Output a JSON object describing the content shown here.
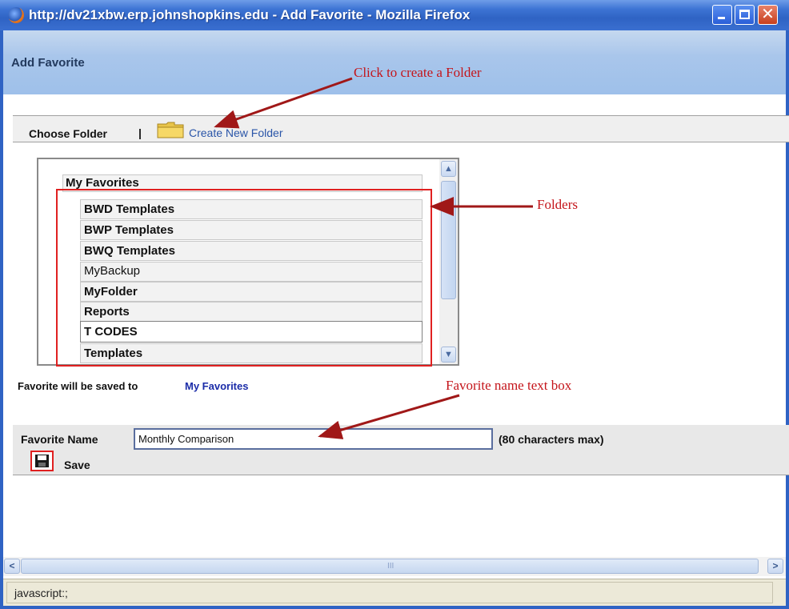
{
  "window": {
    "title": "http://dv21xbw.erp.johnshopkins.edu - Add Favorite - Mozilla Firefox",
    "minimize_glyph": "_",
    "close_glyph": "✕"
  },
  "page": {
    "title": "Add Favorite"
  },
  "annotations": {
    "create_folder": "Click to create a Folder",
    "folders": "Folders",
    "name_box": "Favorite name text box"
  },
  "folder_bar": {
    "choose_label": "Choose Folder",
    "separator": "|",
    "create_link": "Create New Folder"
  },
  "folder_tree": {
    "root": "My Favorites",
    "folders": [
      "BWD Templates",
      "BWP Templates",
      "BWQ Templates",
      "MyBackup",
      "MyFolder",
      "Reports",
      "T CODES",
      "Templates"
    ],
    "selected": "T CODES"
  },
  "saved_to": {
    "label": "Favorite will be saved to",
    "destination": "My Favorites"
  },
  "favorite_name": {
    "label": "Favorite Name",
    "value": "Monthly Comparison",
    "max_note": "(80 characters max)",
    "save_label": "Save"
  },
  "scrollbars": {
    "up_glyph": "▲",
    "down_glyph": "▼",
    "left_glyph": "<",
    "right_glyph": ">",
    "grip_glyph": "III"
  },
  "status_bar": {
    "text": "javascript:;"
  },
  "colors": {
    "annotation": "#c4141a",
    "titlebar": "#3d74d4",
    "link": "#2a55a8"
  }
}
